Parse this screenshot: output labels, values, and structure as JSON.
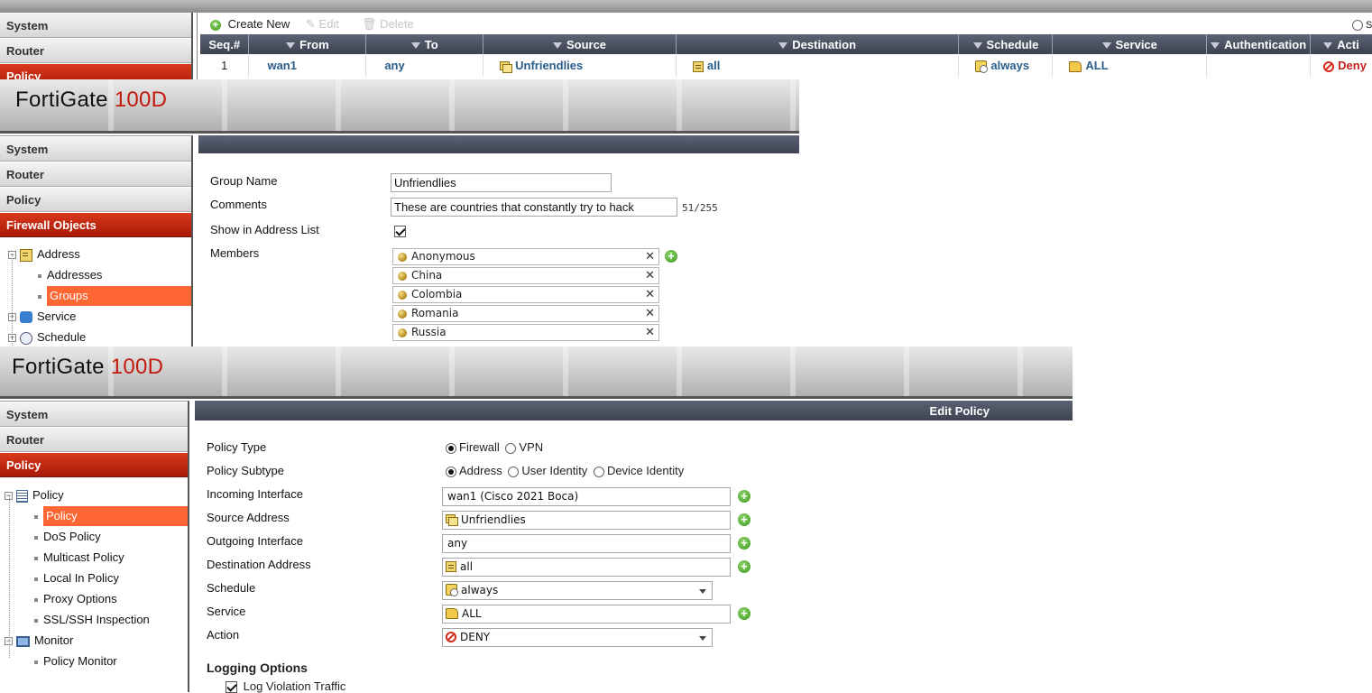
{
  "panel1": {
    "sidebar": [
      "System",
      "Router",
      "Policy"
    ],
    "toolbar": {
      "create": "Create New",
      "edit": "Edit",
      "delete": "Delete",
      "right_fragment": "S"
    },
    "columns": [
      "Seq.#",
      "From",
      "To",
      "Source",
      "Destination",
      "Schedule",
      "Service",
      "Authentication",
      "Acti"
    ],
    "row": {
      "seq": "1",
      "from": "wan1",
      "to": "any",
      "source": "Unfriendlies",
      "destination": "all",
      "schedule": "always",
      "service": "ALL",
      "authentication": "",
      "action": "Deny"
    }
  },
  "panel2": {
    "logo_main": "FortiGate",
    "logo_model": "100D",
    "sidebar": [
      "System",
      "Router",
      "Policy",
      "Firewall Objects"
    ],
    "tree": {
      "address": "Address",
      "addresses": "Addresses",
      "groups": "Groups",
      "service": "Service",
      "schedule": "Schedule"
    },
    "form": {
      "group_name_label": "Group Name",
      "group_name": "Unfriendlies",
      "comments_label": "Comments",
      "comments": "These are countries that constantly try to hack",
      "comments_count": "51/255",
      "show_label": "Show in Address List",
      "members_label": "Members",
      "members": [
        "Anonymous",
        "China",
        "Colombia",
        "Romania",
        "Russia"
      ]
    }
  },
  "panel3": {
    "logo_main": "FortiGate",
    "logo_model": "100D",
    "sidebar": [
      "System",
      "Router",
      "Policy"
    ],
    "title": "Edit Policy",
    "tree": {
      "policy": "Policy",
      "policy_sel": "Policy",
      "dos": "DoS Policy",
      "multicast": "Multicast Policy",
      "local_in": "Local In Policy",
      "proxy": "Proxy Options",
      "ssl": "SSL/SSH Inspection",
      "monitor": "Monitor",
      "policy_monitor": "Policy Monitor"
    },
    "form": {
      "policy_type_label": "Policy Type",
      "opt_firewall": "Firewall",
      "opt_vpn": "VPN",
      "subtype_label": "Policy Subtype",
      "opt_address": "Address",
      "opt_user": "User Identity",
      "opt_device": "Device Identity",
      "incoming_label": "Incoming Interface",
      "incoming": "wan1 (Cisco 2021 Boca)",
      "source_label": "Source Address",
      "source": "Unfriendlies",
      "outgoing_label": "Outgoing Interface",
      "outgoing": "any",
      "dest_label": "Destination Address",
      "dest": "all",
      "schedule_label": "Schedule",
      "schedule": "always",
      "service_label": "Service",
      "service": "ALL",
      "action_label": "Action",
      "action": "DENY",
      "logging_heading": "Logging Options",
      "log_violation": "Log Violation Traffic"
    }
  }
}
